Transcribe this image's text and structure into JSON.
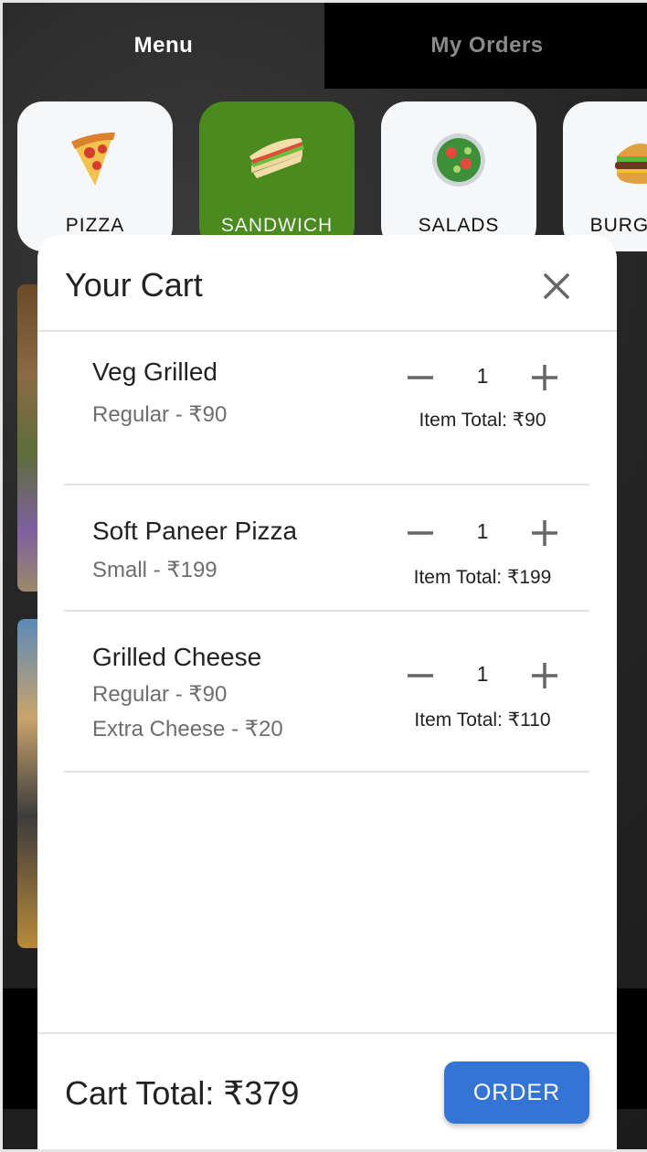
{
  "tabs": [
    {
      "label": "Menu",
      "active": true
    },
    {
      "label": "My Orders",
      "active": false
    }
  ],
  "categories": [
    {
      "label": "PIZZA",
      "icon": "pizza-icon",
      "selected": false
    },
    {
      "label": "SANDWICH",
      "icon": "sandwich-icon",
      "selected": true
    },
    {
      "label": "SALADS",
      "icon": "salad-icon",
      "selected": false
    },
    {
      "label": "BURGERS",
      "icon": "burger-icon",
      "selected": false
    }
  ],
  "cart": {
    "title": "Your Cart",
    "items": [
      {
        "name": "Veg Grilled",
        "options": [
          "Regular - ₹90"
        ],
        "quantity": "1",
        "item_total": "Item Total: ₹90"
      },
      {
        "name": "Soft Paneer Pizza",
        "options": [
          "Small - ₹199"
        ],
        "quantity": "1",
        "item_total": "Item Total: ₹199"
      },
      {
        "name": "Grilled Cheese",
        "options": [
          "Regular - ₹90",
          "Extra Cheese - ₹20"
        ],
        "quantity": "1",
        "item_total": "Item Total: ₹110"
      }
    ],
    "cart_total": "Cart Total: ₹379",
    "order_label": "ORDER"
  },
  "colors": {
    "selected_category": "#4a8a1f",
    "order_button": "#3474d4",
    "inactive_tab_bg": "#000000"
  }
}
